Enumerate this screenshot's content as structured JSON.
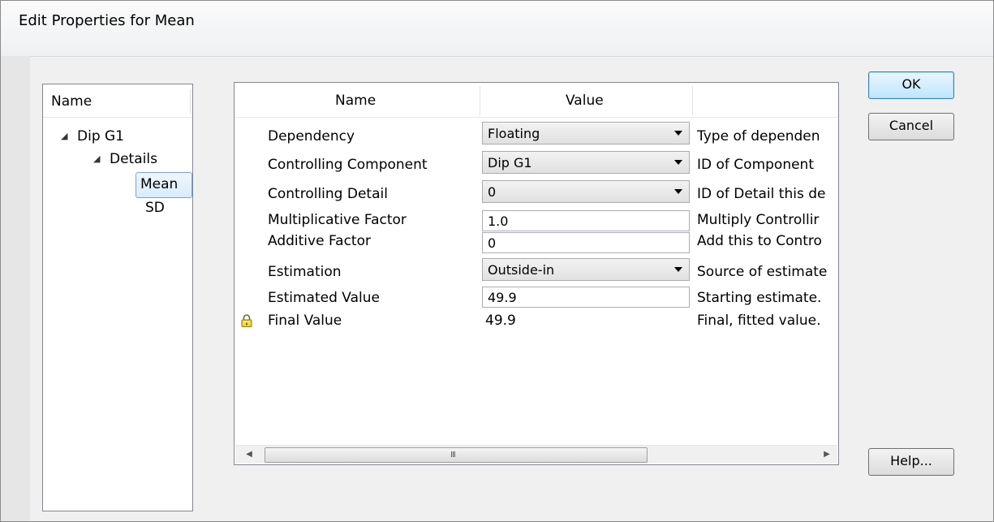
{
  "window": {
    "title": "Edit Properties for Mean"
  },
  "tree": {
    "header": "Name",
    "nodes": [
      {
        "label": "Dip G1",
        "level": 0,
        "expanded": true
      },
      {
        "label": "Details",
        "level": 1,
        "expanded": true
      },
      {
        "label": "Mean",
        "level": 2,
        "selected": true
      },
      {
        "label": "SD",
        "level": 2
      }
    ]
  },
  "grid": {
    "columns": [
      "Name",
      "Value"
    ],
    "rows": [
      {
        "name": "Dependency",
        "type": "combo",
        "value": "Floating",
        "description": "Type of dependen"
      },
      {
        "name": "Controlling Component",
        "type": "combo",
        "value": "Dip G1",
        "description": "ID of Component"
      },
      {
        "name": "Controlling Detail",
        "type": "combo",
        "value": "0",
        "description": "ID of Detail this de"
      },
      {
        "name": "Multiplicative Factor",
        "type": "text",
        "value": "1.0",
        "description": "Multiply Controllir"
      },
      {
        "name": "Additive Factor",
        "type": "text",
        "value": "0",
        "description": "Add this to Contro"
      },
      {
        "name": "Estimation",
        "type": "combo",
        "value": "Outside-in",
        "description": "Source of estimate"
      },
      {
        "name": "Estimated Value",
        "type": "text",
        "value": "49.9",
        "description": "Starting estimate."
      },
      {
        "name": "Final Value",
        "type": "readonly",
        "value": "49.9",
        "description": "Final, fitted value.",
        "locked": true
      }
    ],
    "scrollbar_grip": "III"
  },
  "buttons": {
    "ok": "OK",
    "cancel": "Cancel",
    "help": "Help..."
  },
  "icons": {
    "lock": "lock-icon",
    "tree_expand": "expanded-triangle-icon"
  }
}
